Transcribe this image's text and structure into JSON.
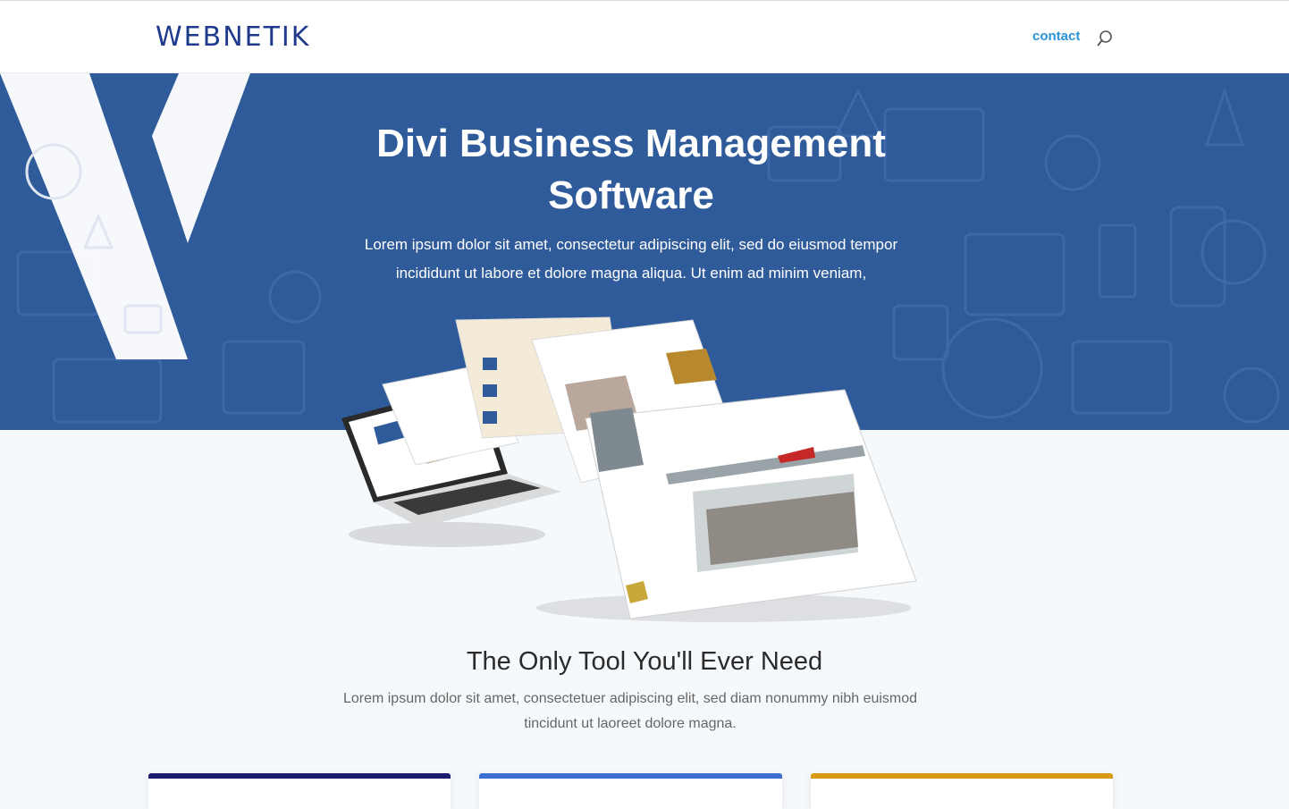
{
  "header": {
    "logo_text": "WEBNETIK",
    "nav": {
      "contact_label": "contact"
    },
    "search_icon": "search-icon"
  },
  "hero": {
    "title": "Divi Business Management Software",
    "subtitle": "Lorem ipsum dolor sit amet, consectetur adipiscing elit, sed do eiusmod tempor incididunt ut labore et dolore magna aliqua. Ut enim ad minim veniam,",
    "background_color": "#2f5b9a"
  },
  "section": {
    "title": "The Only Tool You'll Ever Need",
    "subtitle": "Lorem ipsum dolor sit amet, consectetuer adipiscing elit, sed diam nonummy nibh euismod tincidunt ut laoreet dolore magna."
  },
  "cards": [
    {
      "accent": "#1b1a6e"
    },
    {
      "accent": "#3b6fd1"
    },
    {
      "accent": "#d89a14"
    }
  ],
  "colors": {
    "brand": "#1f3a8c",
    "link": "#2a93d6",
    "page_bg": "#f6f9fc"
  }
}
